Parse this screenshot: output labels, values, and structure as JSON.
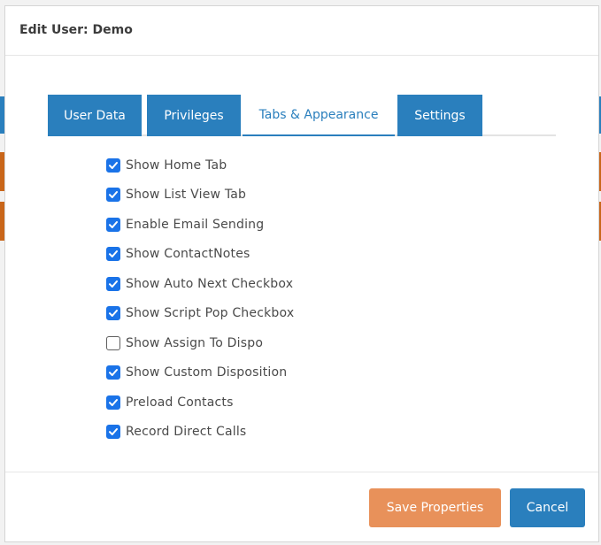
{
  "modal": {
    "title": "Edit User: Demo"
  },
  "tabs": [
    {
      "label": "User Data",
      "active": false
    },
    {
      "label": "Privileges",
      "active": false
    },
    {
      "label": "Tabs & Appearance",
      "active": true
    },
    {
      "label": "Settings",
      "active": false
    }
  ],
  "options": [
    {
      "label": "Show Home Tab",
      "checked": true
    },
    {
      "label": "Show List View Tab",
      "checked": true
    },
    {
      "label": "Enable Email Sending",
      "checked": true
    },
    {
      "label": "Show ContactNotes",
      "checked": true
    },
    {
      "label": "Show Auto Next Checkbox",
      "checked": true
    },
    {
      "label": "Show Script Pop Checkbox",
      "checked": true
    },
    {
      "label": "Show Assign To Dispo",
      "checked": false
    },
    {
      "label": "Show Custom Disposition",
      "checked": true
    },
    {
      "label": "Preload Contacts",
      "checked": true
    },
    {
      "label": "Record Direct Calls",
      "checked": true
    }
  ],
  "footer": {
    "save_label": "Save Properties",
    "cancel_label": "Cancel"
  },
  "colors": {
    "primary": "#2a7fbd",
    "save": "#e8915a",
    "checkbox": "#1a73e8"
  }
}
